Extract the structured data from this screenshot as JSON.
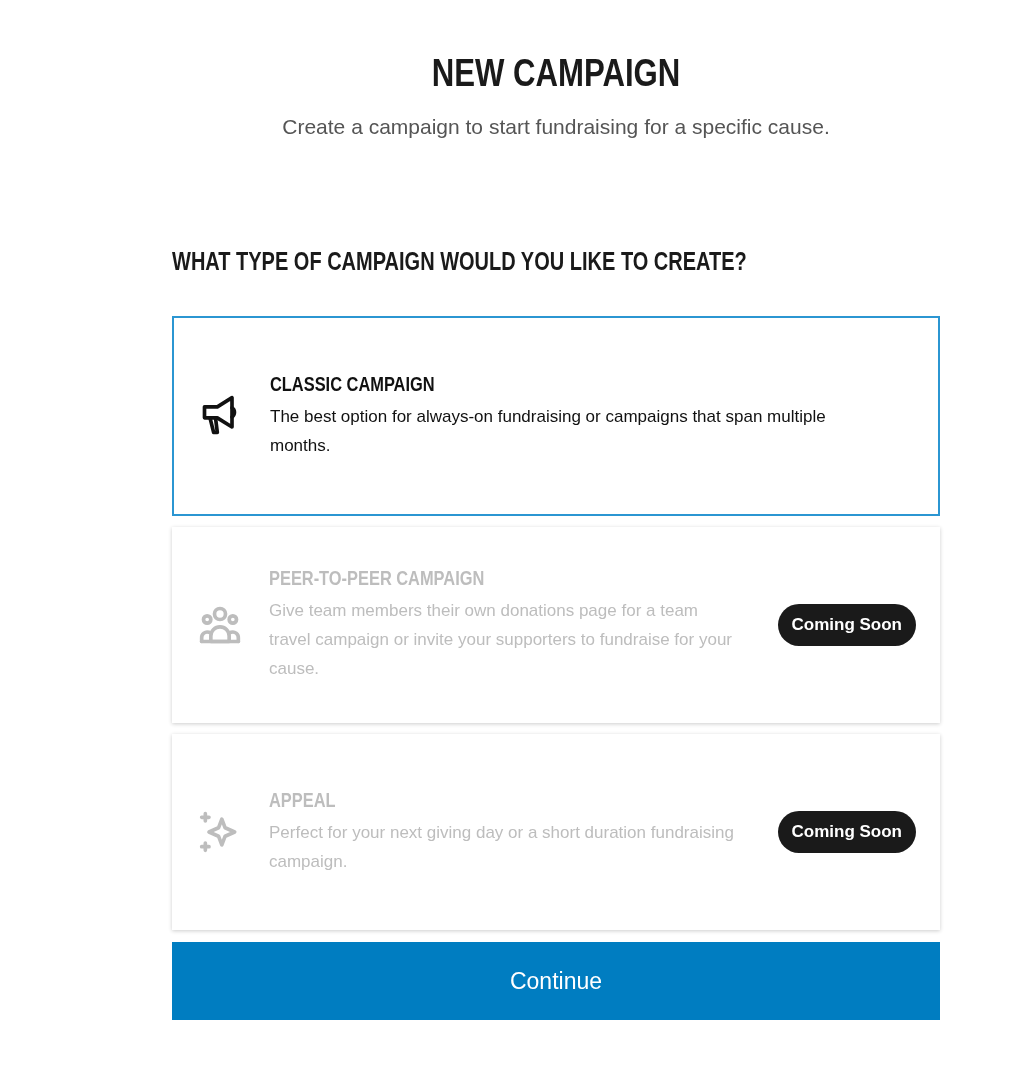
{
  "title": "NEW CAMPAIGN",
  "subtitle": "Create a campaign to start fundraising for a specific cause.",
  "question": "WHAT TYPE OF CAMPAIGN WOULD YOU LIKE TO CREATE?",
  "options": [
    {
      "kind": "megaphone",
      "title": "CLASSIC CAMPAIGN",
      "description": "The best option for always-on fundraising or campaigns that span multiple months.",
      "selected": true,
      "disabled": false
    },
    {
      "kind": "people",
      "title": "PEER-TO-PEER CAMPAIGN",
      "description": "Give team members their own donations page for a team travel campaign or invite your supporters to fundraise for your cause.",
      "selected": false,
      "disabled": true,
      "badge": "Coming Soon"
    },
    {
      "kind": "sparkle",
      "title": "APPEAL",
      "description": "Perfect for your next giving day or a short duration fundraising campaign.",
      "selected": false,
      "disabled": true,
      "badge": "Coming Soon"
    }
  ],
  "continue_button": "Continue"
}
